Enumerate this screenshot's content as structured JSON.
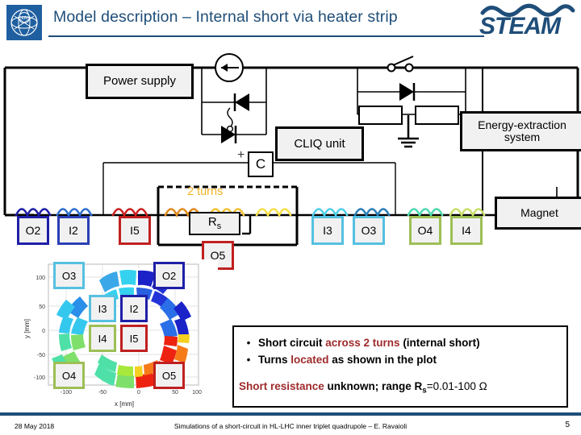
{
  "header": {
    "title": "Model description – Internal short via heater strip",
    "cern_logo_alt": "CERN",
    "steam_logo_alt": "STEAM",
    "accent_color": "#1f4e79"
  },
  "circuit": {
    "power_supply_label": "Power supply",
    "cliq_label": "CLIQ unit",
    "energy_extraction_label": "Energy-extraction system",
    "magnet_label": "Magnet",
    "capacitor_label": "C",
    "capacitor_polarity": "+",
    "short_resistor_label": "Rs",
    "turns_label": "2 turns",
    "turns_color": "#f0b323",
    "coil_tags": [
      {
        "id": "O2",
        "label": "O2",
        "color": "#1f1fa8"
      },
      {
        "id": "I2",
        "label": "I2",
        "color": "#2b3fb5"
      },
      {
        "id": "I5",
        "label": "I5",
        "color": "#c02020"
      },
      {
        "id": "O5",
        "label": "O5",
        "color": "#c02020"
      },
      {
        "id": "I3",
        "label": "I3",
        "color": "#56c0e0"
      },
      {
        "id": "O3",
        "label": "O3",
        "color": "#56c0e0"
      },
      {
        "id": "O4",
        "label": "O4",
        "color": "#9dbf55"
      },
      {
        "id": "I4",
        "label": "I4",
        "color": "#9dbf55"
      }
    ]
  },
  "chart_data": {
    "type": "scatter",
    "title": "",
    "xlabel": "x [mm]",
    "ylabel": "y [mm]",
    "xlim": [
      -130,
      130
    ],
    "ylim": [
      -130,
      130
    ],
    "xticks": [
      "-100",
      "-50",
      "0",
      "50",
      "100"
    ],
    "yticks": [
      "100",
      "50",
      "0",
      "-50",
      "-100"
    ],
    "grid": true,
    "legend_position": "inside",
    "annotations": [
      {
        "label": "O3",
        "x": -85,
        "y": 100,
        "color": "#56c0e0"
      },
      {
        "label": "O2",
        "x": 85,
        "y": 100,
        "color": "#1f1fa8"
      },
      {
        "label": "I3",
        "x": -35,
        "y": 32,
        "color": "#56c0e0"
      },
      {
        "label": "I2",
        "x": 18,
        "y": 32,
        "color": "#1f1fa8"
      },
      {
        "label": "I4",
        "x": -35,
        "y": -18,
        "color": "#9dbf55"
      },
      {
        "label": "I5",
        "x": 18,
        "y": -18,
        "color": "#c02020"
      },
      {
        "label": "O4",
        "x": -85,
        "y": -100,
        "color": "#9dbf55"
      },
      {
        "label": "O5",
        "x": 85,
        "y": -100,
        "color": "#c02020"
      }
    ],
    "description": "Magnet cross-section showing eight coil blocks (quadrupole) coloured by current/temperature scale; short-circuited turns highlighted in red/orange in the O5 and I5 quadrant."
  },
  "notes": {
    "bullets": [
      {
        "dot": "•",
        "parts": [
          {
            "text": "Short circuit ",
            "style": "plain"
          },
          {
            "text": "across 2 turns",
            "style": "red"
          },
          {
            "text": " (internal short)",
            "style": "plain"
          }
        ]
      },
      {
        "dot": "•",
        "parts": [
          {
            "text": "Turns ",
            "style": "plain"
          },
          {
            "text": "located",
            "style": "red"
          },
          {
            "text": " as shown in the plot",
            "style": "plain"
          }
        ]
      }
    ],
    "statement_red": "Short resistance",
    "statement_rest": " unknown; range R",
    "statement_sub": "s",
    "statement_tail": "=0.01-100 Ω",
    "red_color": "#9e2a2b"
  },
  "footer": {
    "date": "28 May 2018",
    "center": "Simulations of a short-circuit in HL-LHC inner triplet quadrupole – E. Ravaioli",
    "page": "5"
  }
}
